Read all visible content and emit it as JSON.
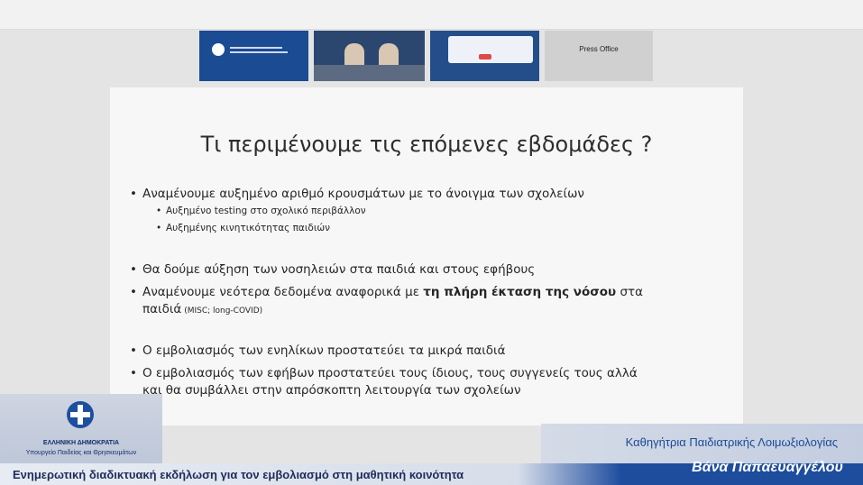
{
  "thumbnails": [
    {
      "name": "ministry-stream"
    },
    {
      "name": "speakers-stream"
    },
    {
      "name": "info-stream"
    },
    {
      "name": "press-office",
      "label": "Press Office"
    }
  ],
  "slide": {
    "title": "Τι περιμένουμε τις επόμενες εβδομάδες ?",
    "bullet_1": "Αναμένουμε αυξημένο αριθμό κρουσμάτων με το άνοιγμα των σχολείων",
    "sub_1": "Αυξημένο testing στο σχολικό περιβάλλον",
    "sub_2": "Αυξημένης κινητικότητας  παιδιών",
    "bullet_2": "Θα δούμε αύξηση των νοσηλειών στα παιδιά και στους εφήβους",
    "bullet_3_pre": "Αναμένουμε νεότερα δεδομένα αναφορικά με ",
    "bullet_3_bold": "τη πλήρη έκταση της νόσου",
    "bullet_3_post": " στα",
    "bullet_3_line2": "παιδιά",
    "bullet_3_note": " (MISC; long-COVID)",
    "bullet_4": "Ο εμβολιασμός των ενηλίκων προστατεύει τα μικρά παιδιά",
    "bullet_5_line1": "Ο εμβολιασμός των εφήβων προστατεύει τους ίδιους, τους συγγενείς τους αλλά",
    "bullet_5_line2": "και θα συμβάλλει στην απρόσκοπτη λειτουργία των σχολείων"
  },
  "overlay": {
    "ministry_name": "ΕΛΛΗΝΙΚΗ ΔΗΜΟΚΡΑΤΙΑ",
    "ministry_sub": "Υπουργείο Παιδείας και Θρησκευμάτων",
    "speaker_role": "Καθηγήτρια Παιδιατρικής Λοιμωξιολογίας",
    "speaker_name": "Βάνα Παπαευαγγέλου",
    "event_title": "Ενημερωτική διαδικτυακή εκδήλωση για τον εμβολιασμό στη μαθητική κοινότητα"
  }
}
